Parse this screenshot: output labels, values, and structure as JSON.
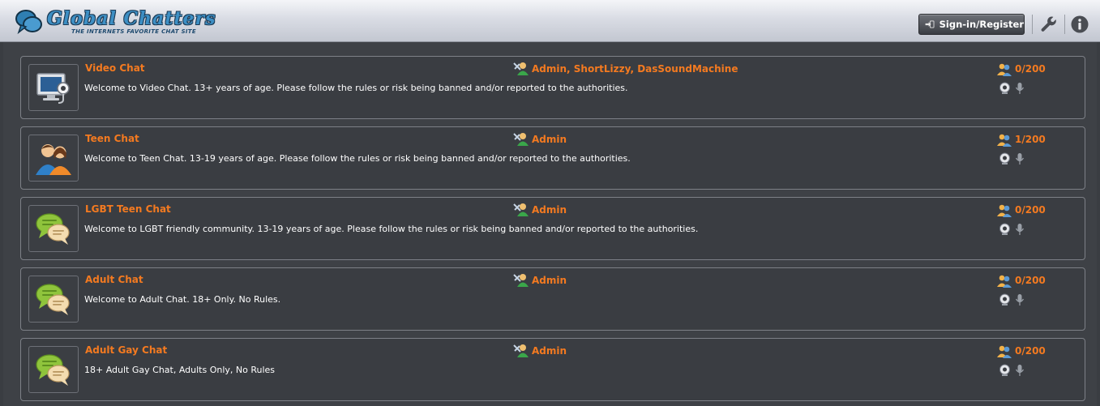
{
  "header": {
    "logo_title": "Global Chatters",
    "logo_tagline": "THE INTERNETS FAVORITE CHAT SITE",
    "signin_label": "Sign-in/Register",
    "settings_icon": "wrench-icon",
    "info_icon": "info-icon"
  },
  "colors": {
    "accent": "#f47a20",
    "header_light": "#f4f5f8",
    "header_dark": "#c3c7d1",
    "panel_bg": "#3e4146",
    "room_border": "#7d8087"
  },
  "rooms": [
    {
      "name": "Video Chat",
      "description": "Welcome to Video Chat.  13+ years of age. Please follow the rules or risk being banned and/or reported to the authorities.",
      "moderators": "Admin, ShortLizzy, DasSoundMachine",
      "users": "0/200",
      "icon": "video-chat-icon"
    },
    {
      "name": "Teen Chat",
      "description": "Welcome to Teen Chat. 13-19 years of age. Please follow the rules or risk being banned and/or reported to the authorities.",
      "moderators": "Admin",
      "users": "1/200",
      "icon": "teens-icon"
    },
    {
      "name": "LGBT Teen Chat",
      "description": "Welcome to LGBT friendly community. 13-19 years of age. Please follow the rules or risk being banned and/or reported to the authorities.",
      "moderators": "Admin",
      "users": "0/200",
      "icon": "chat-bubbles-icon"
    },
    {
      "name": "Adult Chat",
      "description": "Welcome to Adult Chat. 18+ Only. No Rules.",
      "moderators": "Admin",
      "users": "0/200",
      "icon": "chat-bubbles-icon"
    },
    {
      "name": "Adult Gay Chat",
      "description": "18+ Adult Gay Chat, Adults Only, No Rules",
      "moderators": "Admin",
      "users": "0/200",
      "icon": "chat-bubbles-icon"
    }
  ]
}
